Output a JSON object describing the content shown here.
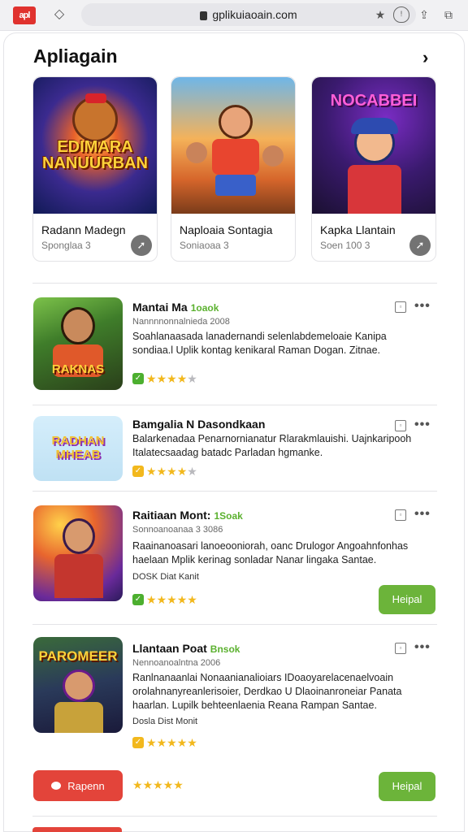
{
  "browser": {
    "logo": "apl",
    "url": "gplikuiaoain.com"
  },
  "section": {
    "title": "Apliagain"
  },
  "featured": [
    {
      "art_title": "EDIMARA NANUURBAN",
      "name": "Radann Madegn",
      "sub": "Sponglaa 3"
    },
    {
      "art_title": "",
      "name": "Naploaia Sontagia",
      "sub": "Soniaoaa 3"
    },
    {
      "art_title": "NOCABBEI",
      "name": "Kapka Llantain",
      "sub": "Soen 100 3"
    }
  ],
  "rows": [
    {
      "icon_text": "RAKNAS",
      "title": "Mantai Ma",
      "tag": "1oaok",
      "sub": "Nannnnonnalnieda 2008",
      "desc": "Soahlanaasada lanadernandi selenlabdemeloaie Kanipa sondiaa.l Uplik kontag kenikaral Raman Dogan.  Zitnae.",
      "meta": "",
      "badge_color": "#4caf2f",
      "stars": 4,
      "button": ""
    },
    {
      "icon_text": "RADHAN MHEAB",
      "title": "Bamgalia N Dasondkaan",
      "tag": "",
      "sub": "",
      "desc": "Balarkenadaa Penarnornianatur Rlarakmlauishi. Uajnkaripooh Italatecsaadag batadc Parladan hgmanke.",
      "meta": "",
      "badge_color": "#f2b81d",
      "stars": 3.5,
      "button": ""
    },
    {
      "icon_text": "",
      "title": "Raitiaan Mont:",
      "tag": "1Soak",
      "sub": "Sonnoanoanaa 3 3086",
      "desc": "Raainanoasari lanoeooniorah, oanc Drulogor Angoahnfonhas haelaan Mplik kerinag sonladar Nanar lingaka  Santae.",
      "meta": "DOSK Diat Kanit",
      "badge_color": "#4caf2f",
      "stars": 4.5,
      "button": "Heipal"
    },
    {
      "icon_text": "PAROMEER",
      "title": "Llantaan Poat",
      "tag": "Bnsok",
      "sub": "Nennoanoalntna 2006",
      "desc": "Ranlnanaanlai Nonaanianalioiars IDoaoyarelacenaelvoain orolahnanyreanlerisoier, Derdkao U Dlaoinanroneiar Panata haarlan. Lupilk behteenlaenia Reana Rampan  Santae.",
      "meta": "Dosla Dist Monit",
      "badge_color": "#f2b81d",
      "stars": 5,
      "button": ""
    }
  ],
  "bottom": {
    "red_button": "Rapenn",
    "green_button": "Heipal",
    "stars": 5
  }
}
